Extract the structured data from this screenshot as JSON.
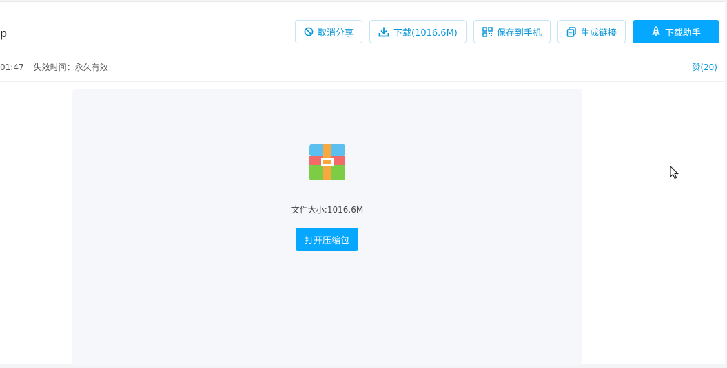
{
  "header": {
    "title_fragment": "p"
  },
  "toolbar": {
    "cancel_share": "取消分享",
    "download": "下载(1016.6M)",
    "save_to_phone": "保存到手机",
    "generate_link": "生成链接",
    "download_assistant": "下载助手"
  },
  "meta": {
    "share_time_fragment": "01:47",
    "expiry": "失效时间：永久有效",
    "like": "赞(20)"
  },
  "preview": {
    "file_size": "文件大小:1016.6M",
    "open_archive": "打开压缩包"
  },
  "colors": {
    "accent": "#06a7ff",
    "link": "#0a97d9",
    "preview_bg": "#f5f7fa"
  }
}
